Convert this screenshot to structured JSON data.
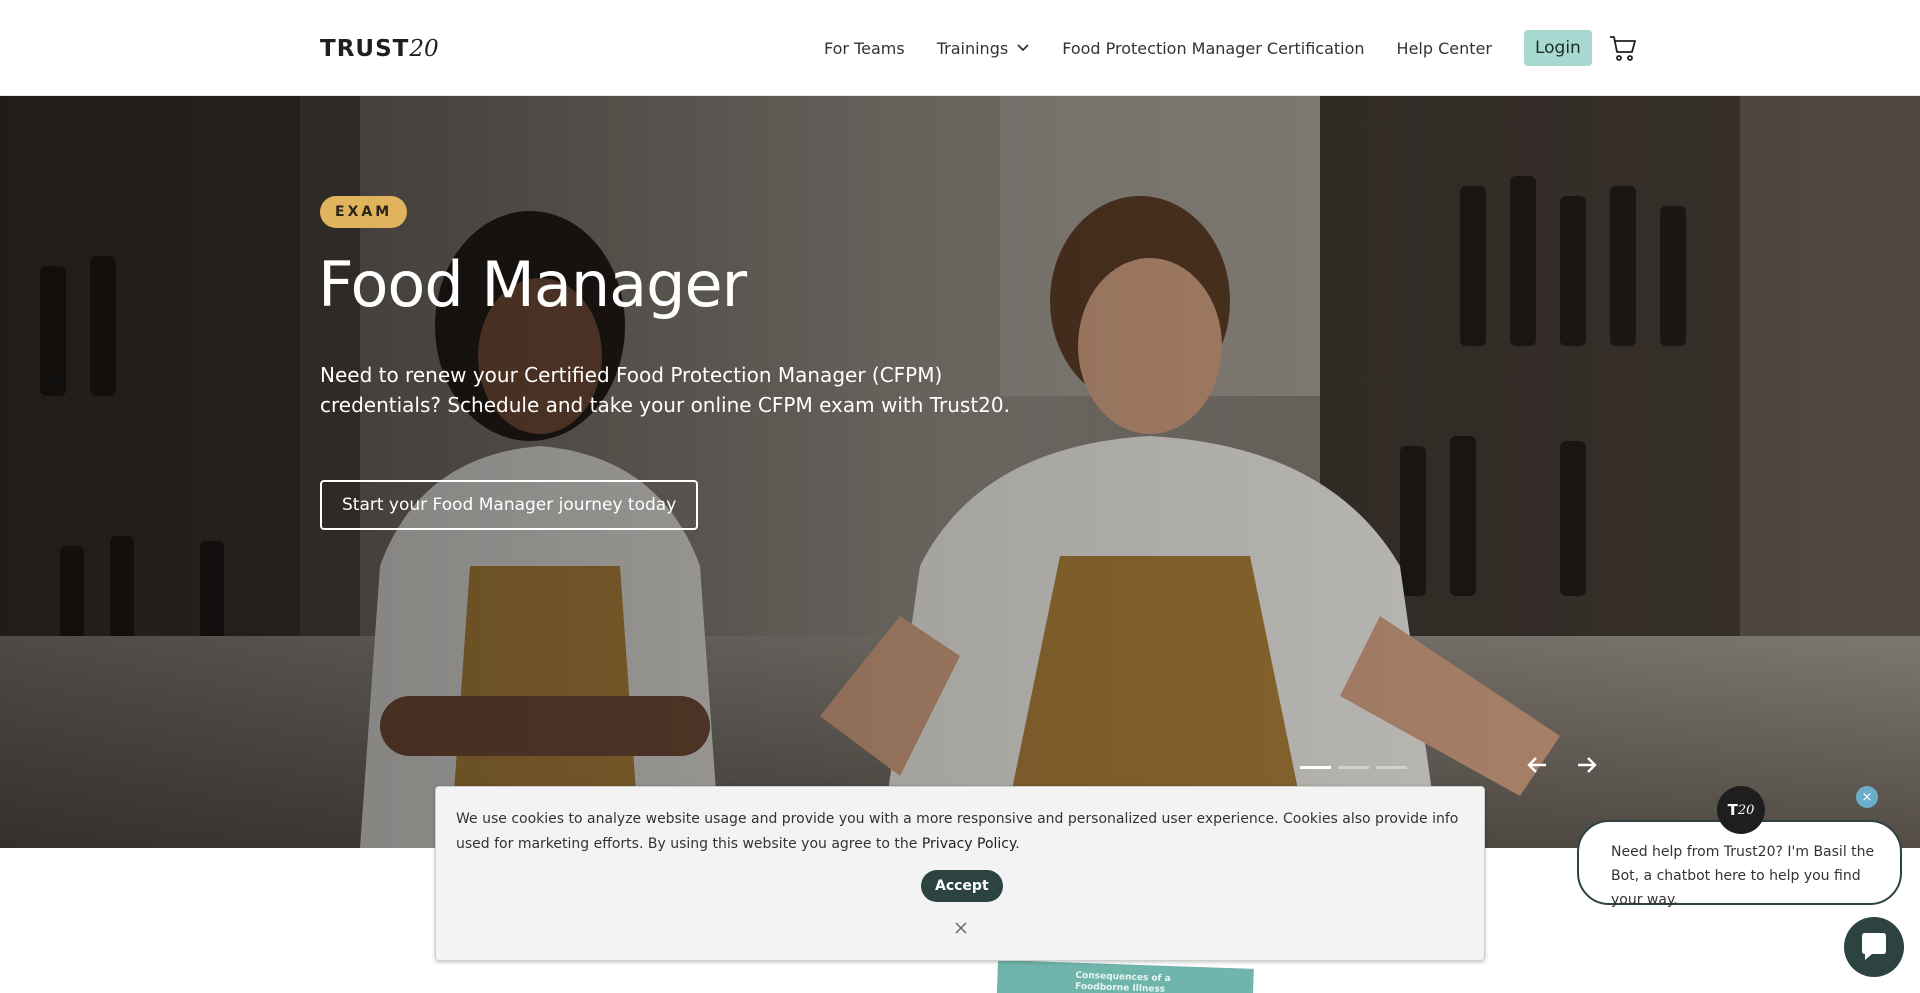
{
  "header": {
    "logo_text": "TRUST",
    "logo_num": "20",
    "nav": [
      {
        "label": "For Teams"
      },
      {
        "label": "Trainings"
      },
      {
        "label": "Food Protection Manager Certification"
      },
      {
        "label": "Help Center"
      }
    ],
    "login_label": "Login",
    "cart_icon": "cart-icon"
  },
  "hero": {
    "badge": "EXAM",
    "title": "Food Manager",
    "description": "Need to renew your Certified Food Protection Manager (CFPM) credentials? Schedule and take your online CFPM exam with Trust20.",
    "cta_label": "Start your Food Manager journey today",
    "slides_total": 3,
    "active_slide": 1
  },
  "cookie": {
    "text": "We use cookies to analyze website usage and provide you with a more responsive and personalized user experience. Cookies also provide info used for marketing efforts. By using this website you agree to the",
    "link": "Privacy Policy",
    "after_link": ".",
    "accept_label": "Accept"
  },
  "peek": {
    "text": "Consequences of a Foodborne Illness Outbreak"
  },
  "chat": {
    "avatar_text": "T",
    "avatar_num": "20",
    "dismiss": "×",
    "message": "Need help from Trust20? I'm Basil the Bot, a chatbot here to help you find your way."
  },
  "colors": {
    "accent": "#a9d8d0",
    "badge": "#e0b35c",
    "dark_teal": "#2c4341"
  }
}
